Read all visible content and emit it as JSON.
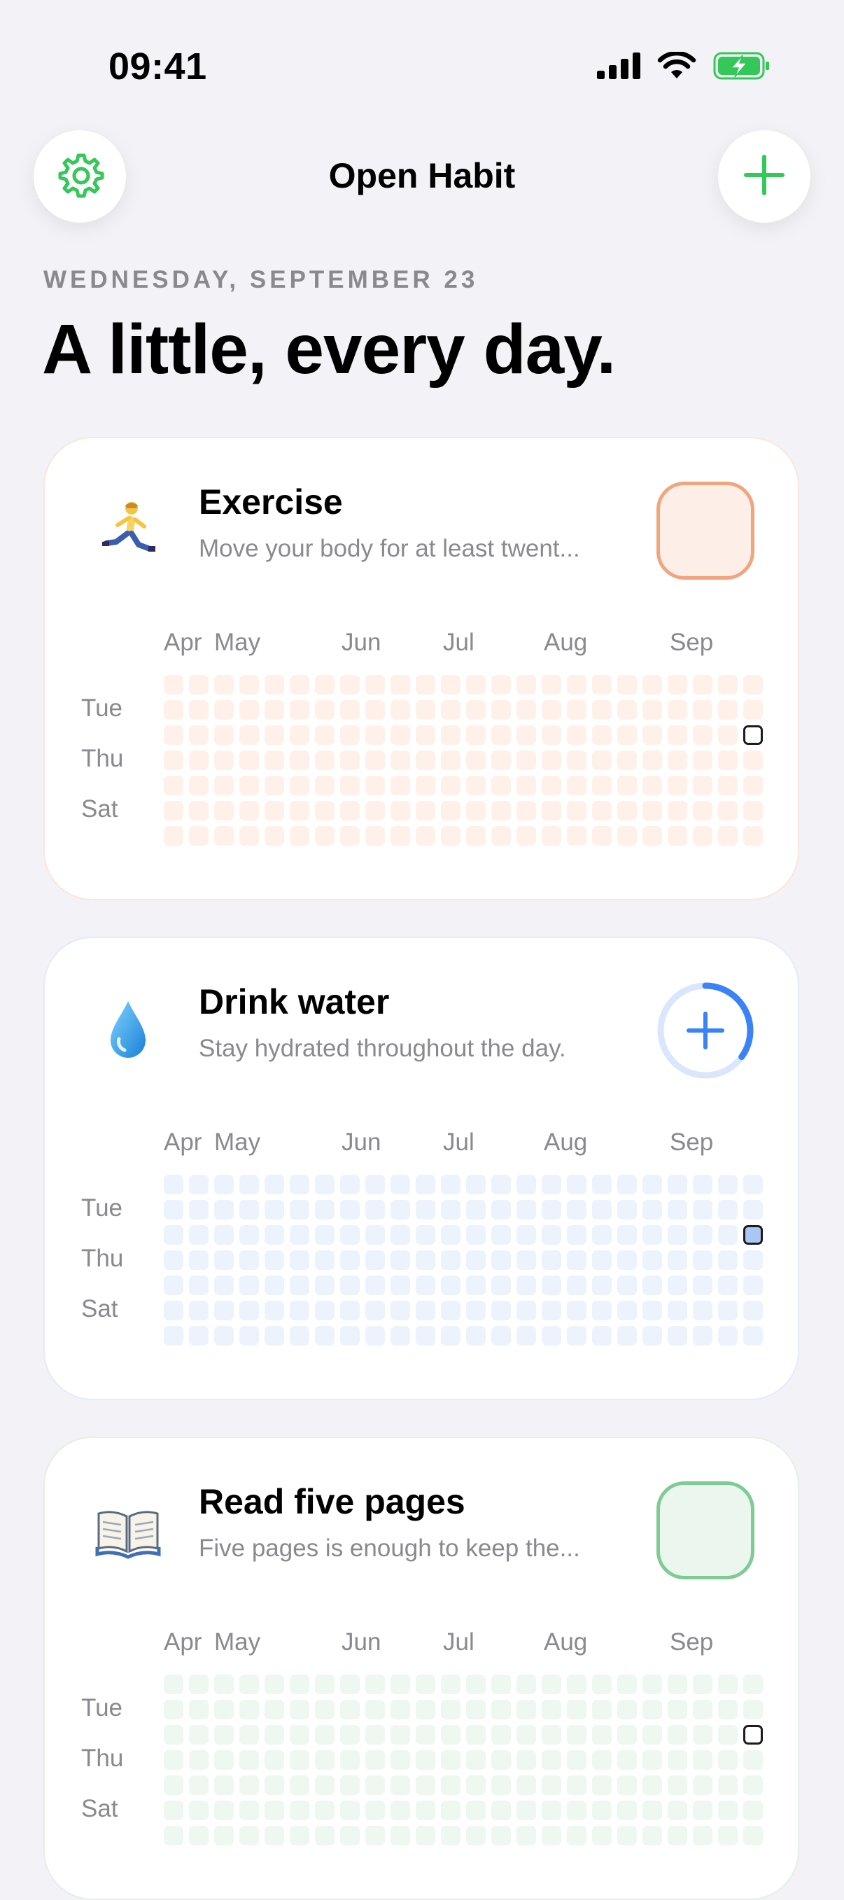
{
  "status_bar": {
    "time": "09:41"
  },
  "header": {
    "title": "Open Habit",
    "settings_icon": "gear-icon",
    "add_icon": "plus-icon"
  },
  "date": "WEDNESDAY, SEPTEMBER 23",
  "headline": "A little, every day.",
  "colors": {
    "green_accent": "#34c759",
    "blue_accent": "#3b82f6",
    "exercise_accent": "#f0a57e",
    "read_accent": "#7fcb94"
  },
  "heatmap": {
    "months": [
      "Apr",
      "May",
      "Jun",
      "Jul",
      "Aug",
      "Sep"
    ],
    "day_labels": [
      "Tue",
      "Thu",
      "Sat"
    ]
  },
  "habits": [
    {
      "name": "Exercise",
      "description": "Move your body for at least twent...",
      "emoji": "🏃",
      "control": "checkbox",
      "done_today": false
    },
    {
      "name": "Drink water",
      "description": "Stay hydrated throughout the day.",
      "emoji": "💧",
      "control": "progress",
      "progress": 0.35
    },
    {
      "name": "Read five pages",
      "description": "Five pages is enough to keep the...",
      "emoji": "📖",
      "control": "checkbox",
      "done_today": false
    }
  ]
}
